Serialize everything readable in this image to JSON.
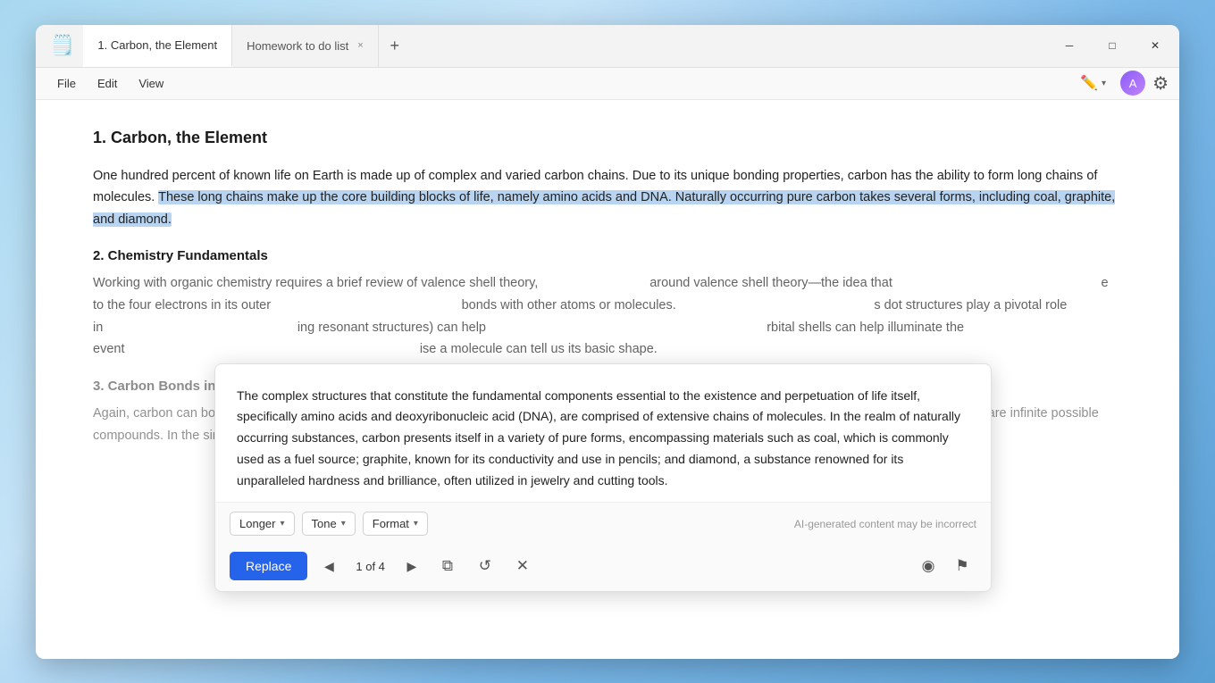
{
  "window": {
    "title": "1. Carbon, the Element",
    "tab2_label": "Homework to do list",
    "tab2_close": "×",
    "tab_add": "+",
    "minimize": "─",
    "maximize": "□",
    "close": "✕"
  },
  "menubar": {
    "file": "File",
    "edit": "Edit",
    "view": "View",
    "settings_icon": "⚙"
  },
  "document": {
    "section1_title": "1. Carbon, the Element",
    "para1_normal": "One hundred percent of known life on Earth is made up of complex and varied carbon chains. Due to its unique bonding properties, carbon has the ability to form long chains of molecules.",
    "para1_highlighted": "These long chains make up the core building blocks of life, namely amino acids and DNA. Naturally occurring pure carbon takes several forms, including coal, graphite, and diamond.",
    "section2_title": "2. Chemistry Fundamentals",
    "para2_text": "Working with organic chemistry requires a brief review of valence shell theory, — around valence shell theory—the idea that — e to the four electrons in its outer — bonds with other atoms or molecules. — s dot structures play a pivotal role in — ing resonant structures) can help — rbital shells can help illuminate the event — ise a molecule can tell us its basic shape.",
    "section3_title": "3. Carbon Bonds in C",
    "para3_text": "Again, carbon can bond up to four bonds with other molecules. In organic chemistry, we mainly focus on carbon chains and hydrogen and oxygen, but there are infinite possible compounds. In the simplest form, carbon bonds with four hydrogen in single bonds. In other instances,"
  },
  "popup": {
    "text": "The complex structures that constitute the fundamental components essential to the existence and perpetuation of life itself, specifically amino acids and deoxyribonucleic acid (DNA), are comprised of extensive chains of molecules. In the realm of naturally occurring substances, carbon presents itself in a variety of pure forms, encompassing materials such as coal, which is commonly used as a fuel source; graphite, known for its conductivity and use in pencils; and diamond, a substance renowned for its unparalleled hardness and brilliance, often utilized in jewelry and cutting tools.",
    "longer_label": "Longer",
    "tone_label": "Tone",
    "format_label": "Format",
    "disclaimer": "AI-generated content may be incorrect",
    "replace_label": "Replace",
    "nav_prev": "◀",
    "counter": "1 of 4",
    "nav_next": "▶",
    "copy_icon": "⧉",
    "refresh_icon": "↺",
    "close_icon": "✕",
    "like_icon": "◉",
    "flag_icon": "⚑"
  }
}
